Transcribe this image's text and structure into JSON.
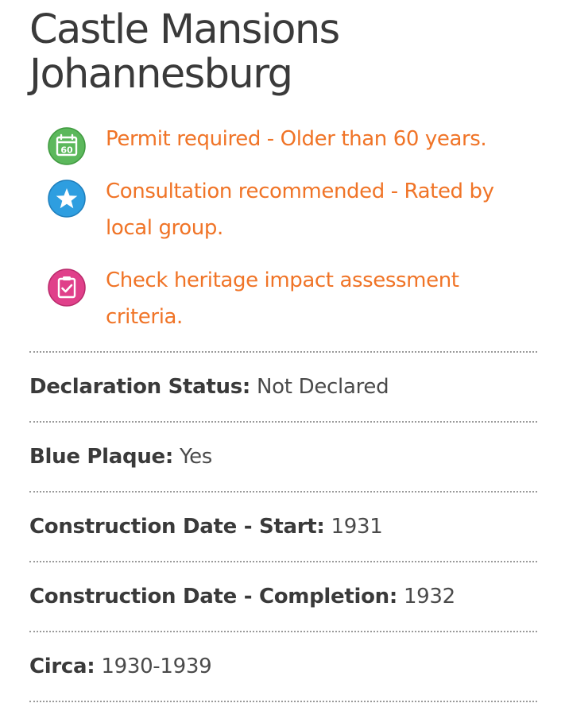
{
  "title": {
    "line1": "Castle Mansions",
    "line2": "Johannesburg"
  },
  "notices": [
    {
      "icon": "calendar-60-icon",
      "text": "Permit required - Older than 60 years.",
      "icon_color": "#5cb85c",
      "icon_label": "60"
    },
    {
      "icon": "star-icon",
      "text": "Consultation recommended - Rated by local group.",
      "icon_color": "#2e9ee0"
    },
    {
      "icon": "clipboard-check-icon",
      "text": "Check heritage impact assessment criteria.",
      "icon_color": "#e0408a"
    }
  ],
  "details": [
    {
      "label": "Declaration Status:",
      "value": "Not Declared"
    },
    {
      "label": "Blue Plaque:",
      "value": "Yes"
    },
    {
      "label": "Construction Date - Start:",
      "value": "1931"
    },
    {
      "label": "Construction Date - Completion:",
      "value": "1932"
    },
    {
      "label": "Circa:",
      "value": "1930-1939"
    }
  ],
  "colors": {
    "accent": "#f07427",
    "text": "#3a3a3a",
    "divider": "#9a9a9a"
  }
}
